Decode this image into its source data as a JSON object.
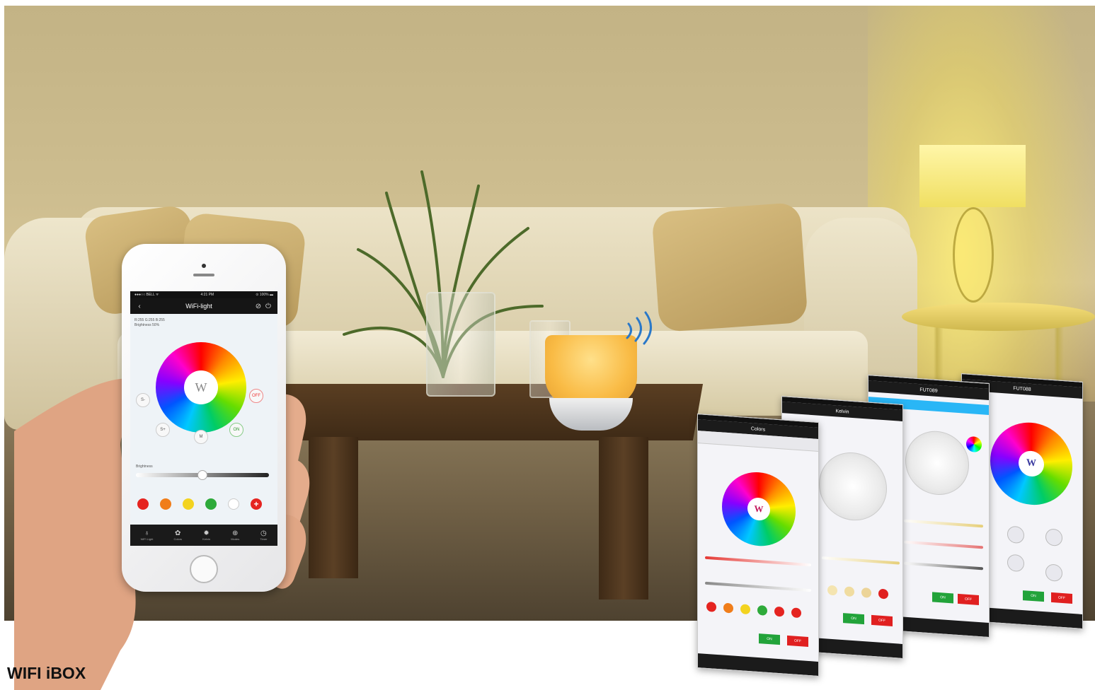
{
  "caption": "WIFI iBOX",
  "phone": {
    "status_carrier": "●●●○○ BELL ᯤ",
    "status_time": "4:21 PM",
    "status_battery": "⊙ 100% ▬",
    "app_title": "WiFi-light",
    "rgb_text": "R:255 G:255 B:255",
    "brightness_text": "Brightness 50%",
    "wheel_center": "W",
    "buttons": {
      "s_minus": "S-",
      "s_plus": "S+",
      "mode": "M",
      "off": "OFF",
      "on": "ON"
    },
    "slider_label": "Brightness",
    "brightness": 0.5,
    "swatches": [
      "#e52420",
      "#f07d1a",
      "#f3d320",
      "#2eaa3a",
      "#ffffff"
    ],
    "add_swatch": "+",
    "tabs": [
      {
        "icon": "bulb-icon",
        "label": "WiFi Light"
      },
      {
        "icon": "palette-icon",
        "label": "Colors"
      },
      {
        "icon": "sun-icon",
        "label": "Kelvin"
      },
      {
        "icon": "globe-icon",
        "label": "Modes"
      },
      {
        "icon": "clock-icon",
        "label": "Timer"
      }
    ]
  },
  "cards": [
    {
      "title": "Colors",
      "wheel_center": "W",
      "on": "ON",
      "off": "OFF"
    },
    {
      "title": "Kelvin",
      "on": "ON",
      "off": "OFF"
    },
    {
      "title": "FUT089",
      "on": "ON",
      "off": "OFF"
    },
    {
      "title": "FUT088",
      "wheel_center": "W",
      "on": "ON",
      "off": "OFF"
    }
  ],
  "colors": {
    "caption": "#111111",
    "on_button": "#22a33a",
    "off_button": "#e02020",
    "ibox_glow": "#f9bb45"
  }
}
